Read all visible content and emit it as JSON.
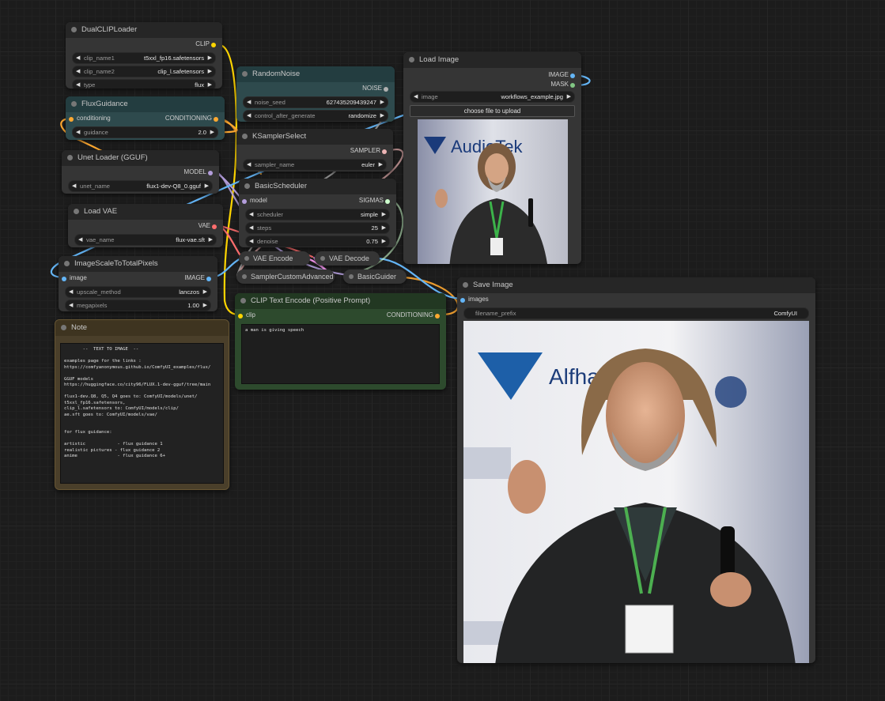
{
  "colors": {
    "clip": "#ffd500",
    "conditioning": "#ffa931",
    "model": "#b39ddb",
    "vae": "#ff6e6e",
    "image": "#64b5f6",
    "latent": "#ff9cf9",
    "noise": "#b0b0b0",
    "sampler": "#ecb4b4",
    "sigmas": "#cdffcd",
    "mask": "#81c784"
  },
  "nodes": {
    "dualclip": {
      "title": "DualCLIPLoader",
      "out": "CLIP",
      "w1_label": "clip_name1",
      "w1_value": "t5xxl_fp16.safetensors",
      "w2_label": "clip_name2",
      "w2_value": "clip_l.safetensors",
      "w3_label": "type",
      "w3_value": "flux"
    },
    "fluxguidance": {
      "title": "FluxGuidance",
      "in": "conditioning",
      "out": "CONDITIONING",
      "w1_label": "guidance",
      "w1_value": "2.0"
    },
    "unet": {
      "title": "Unet Loader (GGUF)",
      "out": "MODEL",
      "w1_label": "unet_name",
      "w1_value": "flux1-dev-Q8_0.gguf"
    },
    "vae": {
      "title": "Load VAE",
      "out": "VAE",
      "w1_label": "vae_name",
      "w1_value": "flux-vae.sft"
    },
    "scale": {
      "title": "ImageScaleToTotalPixels",
      "in": "image",
      "out": "IMAGE",
      "w1_label": "upscale_method",
      "w1_value": "lanczos",
      "w2_label": "megapixels",
      "w2_value": "1.00"
    },
    "randomnoise": {
      "title": "RandomNoise",
      "out": "NOISE",
      "w1_label": "noise_seed",
      "w1_value": "627435209439247",
      "w2_label": "control_after_generate",
      "w2_value": "randomize"
    },
    "ksampler": {
      "title": "KSamplerSelect",
      "out": "SAMPLER",
      "w1_label": "sampler_name",
      "w1_value": "euler"
    },
    "scheduler": {
      "title": "BasicScheduler",
      "in": "model",
      "out": "SIGMAS",
      "w1_label": "scheduler",
      "w1_value": "simple",
      "w2_label": "steps",
      "w2_value": "25",
      "w3_label": "denoise",
      "w3_value": "0.75"
    },
    "loadimage": {
      "title": "Load Image",
      "out1": "IMAGE",
      "out2": "MASK",
      "w1_label": "image",
      "w1_value": "workflows_example.jpg",
      "button": "choose file to upload"
    },
    "vaeencode": {
      "title": "VAE Encode"
    },
    "vaedecode": {
      "title": "VAE Decode"
    },
    "samplercustom": {
      "title": "SamplerCustomAdvanced"
    },
    "basicguider": {
      "title": "BasicGuider"
    },
    "cliptext": {
      "title": "CLIP Text Encode (Positive Prompt)",
      "in": "clip",
      "out": "CONDITIONING",
      "text": "a man is giving speech"
    },
    "note": {
      "title": "Note",
      "text": "       --  TEXT TO IMAGE  --\n\nexamples page for the links :\nhttps://comfyanonymous.github.io/ComfyUI_examples/flux/\n\nGGUF models\nhttps://huggingface.co/city96/FLUX.1-dev-gguf/tree/main\n\nflux1-dev.Q8, Q5, Q4 goes to: ComfyUI/models/unet/\nt5xxl_fp16.safetensors,\nclip_l.safetensors to: ComfyUI/models/clip/\nae.sft goes to: ComfyUI/models/vae/\n\n\nfor flux guidance:\n\nartistic            - flux guidance 1\nrealistic pictures - flux guidance 2\nanime               - flux guidance 6+"
    },
    "saveimage": {
      "title": "Save Image",
      "in": "images",
      "w1_label": "filename_prefix",
      "w1_value": "ComfyUI"
    }
  },
  "images": {
    "preview_banner": "AudioTek",
    "output_banner": "Alfhamar Hano"
  }
}
